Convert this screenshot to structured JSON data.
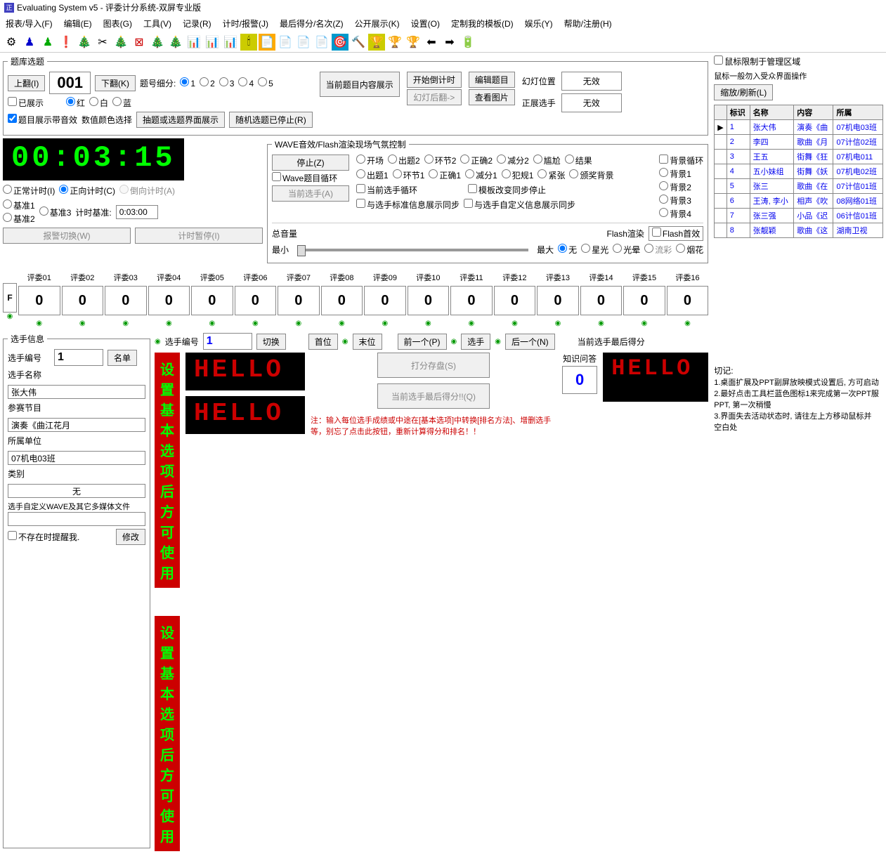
{
  "window": {
    "title": "Evaluating System v5 - 评委计分系统-双屏专业版"
  },
  "menu": [
    "报表/导入(F)",
    "编辑(E)",
    "图表(G)",
    "工具(V)",
    "记录(R)",
    "计时/报警(J)",
    "最后得分/名次(Z)",
    "公开展示(K)",
    "设置(O)",
    "定制我的模板(D)",
    "娱乐(Y)",
    "帮助/注册(H)"
  ],
  "qbank": {
    "legend": "题库选题",
    "up": "上翻(I)",
    "num": "001",
    "down": "下翻(K)",
    "detail_label": "题号细分:",
    "detail_opts": [
      "1",
      "2",
      "3",
      "4",
      "5"
    ],
    "shown_chk": "已展示",
    "color_opts": [
      "红",
      "白",
      "蓝"
    ],
    "effect_chk": "题目展示带音效",
    "color_label": "数值颜色选择",
    "draw_btn": "抽题或选题界面展示",
    "rand_btn": "随机选题已停止(R)",
    "curq_btn": "当前题目内容展示",
    "start_timer": "开始倒计时",
    "slide_after": "幻灯后翻->",
    "edit_q": "编辑题目",
    "view_pic": "查看图片",
    "slide_pos": "幻灯位置",
    "cur_player": "正展选手",
    "none": "无效"
  },
  "timer": {
    "display": "00:03:15",
    "normal": "正常计时(I)",
    "forward": "正向计时(C)",
    "reverse": "倒向计时(A)",
    "base1": "基准1",
    "base2": "基准2",
    "base3": "基准3",
    "base_label": "计时基准:",
    "base_val": "0:03:00",
    "alarm": "报警切换(W)",
    "pause": "计时暂停(I)"
  },
  "wave": {
    "legend": "WAVE音效/Flash渲染现场气氛控制",
    "stop": "停止(Z)",
    "loop_chk": "Wave题目循环",
    "curplayer": "当前选手(A)",
    "opts1": [
      "开场",
      "出题2",
      "环节2",
      "正确2",
      "减分2",
      "尴尬",
      "结果"
    ],
    "opts2": [
      "出题1",
      "环节1",
      "正确1",
      "减分1",
      "犯规1",
      "紧张",
      "颁奖背景"
    ],
    "bg_loop": "背景循环",
    "bgs": [
      "背景1",
      "背景2",
      "背景3",
      "背景4"
    ],
    "cur_loop": "当前选手循环",
    "sync1": "与选手标准信息展示同步",
    "tpl_stop": "模板改变同步停止",
    "sync2": "与选手自定义信息展示同步",
    "vol_label": "总音量",
    "vol_min": "最小",
    "vol_max": "最大",
    "flash_label": "Flash渲染",
    "flash_chk": "Flash首效",
    "flash_opts": [
      "无",
      "星光",
      "光晕",
      "流彩",
      "烟花"
    ]
  },
  "judges": {
    "labels": [
      "评委01",
      "评委02",
      "评委03",
      "评委04",
      "评委05",
      "评委06",
      "评委07",
      "评委08",
      "评委09",
      "评委10",
      "评委11",
      "评委12",
      "评委13",
      "评委14",
      "评委15",
      "评委16"
    ],
    "scores": [
      "0",
      "0",
      "0",
      "0",
      "0",
      "0",
      "0",
      "0",
      "0",
      "0",
      "0",
      "0",
      "0",
      "0",
      "0",
      "0"
    ],
    "fkey": "F"
  },
  "player": {
    "legend": "选手信息",
    "no_label": "选手编号",
    "no_val": "1",
    "list_btn": "名单",
    "name_label": "选手名称",
    "name_val": "张大伟",
    "item_label": "参赛节目",
    "item_val": "演奏《曲江花月",
    "unit_label": "所属单位",
    "unit_val": "07机电03班",
    "type_label": "类别",
    "type_val": "无",
    "custom_label": "选手自定义WAVE及其它多媒体文件",
    "noexist_chk": "不存在时提醒我.",
    "modify": "修改",
    "midno_label": "选手编号",
    "midno_val": "1",
    "switch": "切换",
    "first": "首位",
    "last": "末位",
    "prev": "前一个(P)",
    "sel": "选手",
    "next": "后一个(N)",
    "setmsg": "设置基本选项后方可使用",
    "savescore": "打分存盘(S)",
    "quiz_label": "知识问答",
    "quiz_val": "0",
    "finalbtn": "当前选手最后得分!!(Q)",
    "final_label": "当前选手最后得分",
    "note": "注：输入每位选手成绩或中途在[基本选项]中转换[排名方法]、增删选手等，别忘了点击此按钮，重新计算得分和排名！！"
  },
  "right": {
    "lock_chk": "鼠标限制于管理区域",
    "hint": "鼠标一般勿入受众界面操作",
    "zoom_btn": "缩放/刷新(L)",
    "cols": [
      "标识",
      "名称",
      "内容",
      "所属"
    ],
    "rows": [
      [
        "1",
        "张大伟",
        "演奏《曲",
        "07机电03班"
      ],
      [
        "2",
        "李四",
        "歌曲《月",
        "07计信02班"
      ],
      [
        "3",
        "王五",
        "街舞《狂",
        "07机电011"
      ],
      [
        "4",
        "五小妹组",
        "街舞《妖",
        "07机电02班"
      ],
      [
        "5",
        "张三",
        "歌曲《在",
        "07计信01班"
      ],
      [
        "6",
        "王涛, 李小",
        "相声《吹",
        "08网络01班"
      ],
      [
        "7",
        "张三强",
        "小品《迟",
        "06计信01班"
      ],
      [
        "8",
        "张靓颖",
        "歌曲《这",
        "湖南卫视"
      ]
    ],
    "log_label": "切记:",
    "log": [
      "1.桌面扩展及PPT副屏放映模式设置后, 方可启动",
      "2.最好点击工具栏蓝色图标1来完成第一次PPT服",
      "PPT, 第一次稍慢",
      "3.界面失去活动状态时, 请往左上方移动鼠标并",
      "空白处"
    ]
  }
}
